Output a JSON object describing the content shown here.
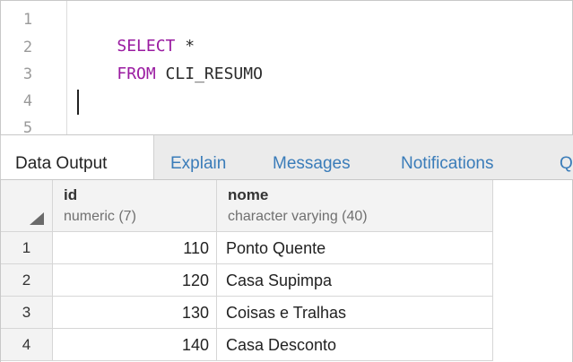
{
  "editor": {
    "line_numbers": [
      "1",
      "2",
      "3",
      "4",
      "5"
    ],
    "lines": [
      {
        "keyword": "SELECT",
        "rest": " *"
      },
      {
        "keyword": "FROM",
        "rest": " CLI_RESUMO"
      }
    ]
  },
  "tabs": [
    {
      "label": "Data Output"
    },
    {
      "label": "Explain"
    },
    {
      "label": "Messages"
    },
    {
      "label": "Notifications"
    },
    {
      "label": "Q"
    }
  ],
  "grid": {
    "columns": [
      {
        "name": "id",
        "type": "numeric (7)"
      },
      {
        "name": "nome",
        "type": "character varying (40)"
      }
    ],
    "rows": [
      {
        "num": "1",
        "id": "110",
        "nome": "Ponto Quente"
      },
      {
        "num": "2",
        "id": "120",
        "nome": "Casa Supimpa"
      },
      {
        "num": "3",
        "id": "130",
        "nome": "Coisas e Tralhas"
      },
      {
        "num": "4",
        "id": "140",
        "nome": "Casa Desconto"
      }
    ]
  }
}
